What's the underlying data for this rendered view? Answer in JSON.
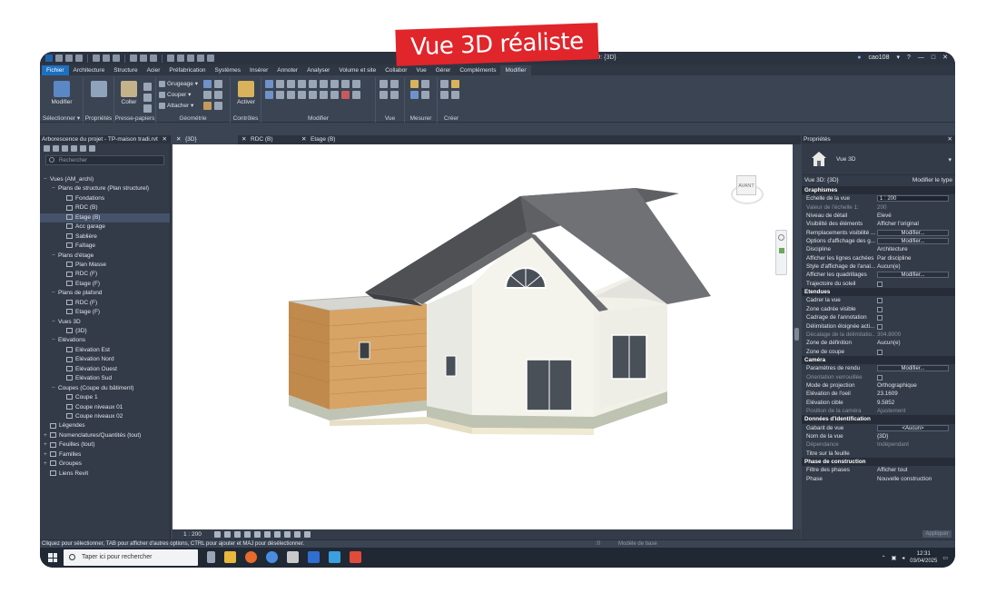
{
  "banner": "Vue 3D réaliste",
  "titlebar": {
    "view_title": "- 3D: {3D}",
    "user": "cao108"
  },
  "tabs": [
    "Fichier",
    "Architecture",
    "Structure",
    "Acier",
    "Préfabrication",
    "Systèmes",
    "Insérer",
    "Annoter",
    "Analyser",
    "Volume et site",
    "Collabor",
    "Vue",
    "Gérer",
    "Compléments",
    "Modifier"
  ],
  "ribbon": {
    "select": {
      "big": "Modifier",
      "label": "Sélectionner ▾"
    },
    "properties": {
      "label": "Propriétés"
    },
    "clipboard": {
      "big": "Coller",
      "label": "Presse-papiers"
    },
    "geometry": {
      "items": [
        "Grugeage ▾",
        "Couper ▾",
        "Attacher ▾"
      ],
      "label": "Géométrie"
    },
    "controls": {
      "big": "Activer",
      "label": "Contrôles"
    },
    "modify": {
      "label": "Modifier"
    },
    "view": {
      "label": "Vue"
    },
    "measure": {
      "label": "Mesurer"
    },
    "create": {
      "label": "Créer"
    }
  },
  "browser": {
    "title": "Arborescence du projet - TP-maison tradi.rvt",
    "search_placeholder": "Rechercher",
    "tree": [
      {
        "t": "Vues (AM_archi)",
        "toggle": "−",
        "indent": 0
      },
      {
        "t": "Plans de structure (Plan structurel)",
        "toggle": "−",
        "indent": 1
      },
      {
        "t": "Fondations",
        "indent": 2,
        "icon": true
      },
      {
        "t": "RDC (B)",
        "indent": 2,
        "icon": true
      },
      {
        "t": "Etage (B)",
        "indent": 2,
        "icon": true,
        "sel": true
      },
      {
        "t": "Acc garage",
        "indent": 2,
        "icon": true
      },
      {
        "t": "Sablière",
        "indent": 2,
        "icon": true
      },
      {
        "t": "Faîtage",
        "indent": 2,
        "icon": true
      },
      {
        "t": "Plans d'étage",
        "toggle": "−",
        "indent": 1
      },
      {
        "t": "Plan Masse",
        "indent": 2,
        "icon": true
      },
      {
        "t": "RDC (F)",
        "indent": 2,
        "icon": true
      },
      {
        "t": "Etage (F)",
        "indent": 2,
        "icon": true
      },
      {
        "t": "Plans de plafond",
        "toggle": "−",
        "indent": 1
      },
      {
        "t": "RDC (F)",
        "indent": 2,
        "icon": true
      },
      {
        "t": "Etage (F)",
        "indent": 2,
        "icon": true
      },
      {
        "t": "Vues 3D",
        "toggle": "−",
        "indent": 1
      },
      {
        "t": "{3D}",
        "indent": 2,
        "icon": true
      },
      {
        "t": "Elévations",
        "toggle": "−",
        "indent": 1
      },
      {
        "t": "Elévation Est",
        "indent": 2,
        "icon": true
      },
      {
        "t": "Elévation Nord",
        "indent": 2,
        "icon": true
      },
      {
        "t": "Elévation Ouest",
        "indent": 2,
        "icon": true
      },
      {
        "t": "Elévation Sud",
        "indent": 2,
        "icon": true
      },
      {
        "t": "Coupes (Coupe du bâtiment)",
        "toggle": "−",
        "indent": 1
      },
      {
        "t": "Coupe 1",
        "indent": 2,
        "icon": true
      },
      {
        "t": "Coupe niveaux 01",
        "indent": 2,
        "icon": true
      },
      {
        "t": "Coupe niveaux 02",
        "indent": 2,
        "icon": true
      },
      {
        "t": "Légendes",
        "indent": 0,
        "icon": true
      },
      {
        "t": "Nomenclatures/Quantités (tout)",
        "toggle": "+",
        "indent": 0,
        "icon": true
      },
      {
        "t": "Feuilles (tout)",
        "toggle": "+",
        "indent": 0,
        "icon": true
      },
      {
        "t": "Familles",
        "toggle": "+",
        "indent": 0,
        "icon": true
      },
      {
        "t": "Groupes",
        "toggle": "+",
        "indent": 0,
        "icon": true
      },
      {
        "t": "Liens Revit",
        "indent": 0,
        "icon": true
      }
    ]
  },
  "view_tabs": [
    "{3D}",
    "RDC (B)",
    "Etage (B)"
  ],
  "viewcube_label": "AVANT",
  "viewbar": {
    "scale": "1 : 200"
  },
  "properties": {
    "title": "Propriétés",
    "type_name": "Vue 3D",
    "selector": "Vue 3D: {3D}",
    "edit_type": "Modifier le type",
    "apply": "Appliquer",
    "rows": [
      {
        "sec": "Graphismes"
      },
      {
        "k": "Echelle de la vue",
        "v": "1 : 200",
        "kind": "input"
      },
      {
        "k": "Valeur de l'échelle    1:",
        "v": "200",
        "dim": true
      },
      {
        "k": "Niveau de détail",
        "v": "Elevé"
      },
      {
        "k": "Visibilité des éléments",
        "v": "Afficher l'original"
      },
      {
        "k": "Remplacements visibilité ...",
        "v": "Modifier...",
        "kind": "btn"
      },
      {
        "k": "Options d'affichage des g...",
        "v": "Modifier...",
        "kind": "btn"
      },
      {
        "k": "Discipline",
        "v": "Architecture"
      },
      {
        "k": "Afficher les lignes cachées",
        "v": "Par discipline"
      },
      {
        "k": "Style d'affichage de l'anal...",
        "v": "Aucun(e)"
      },
      {
        "k": "Afficher les quadrillages",
        "v": "Modifier...",
        "kind": "btn"
      },
      {
        "k": "Trajectoire du soleil",
        "kind": "cb"
      },
      {
        "sec": "Etendues"
      },
      {
        "k": "Cadrer la vue",
        "kind": "cb"
      },
      {
        "k": "Zone cadrée visible",
        "kind": "cb"
      },
      {
        "k": "Cadrage de l'annotation",
        "kind": "cb"
      },
      {
        "k": "Délimitation éloignée acti...",
        "kind": "cb"
      },
      {
        "k": "Décalage de la délimitatio...",
        "v": "304.8000",
        "dim": true
      },
      {
        "k": "Zone de définition",
        "v": "Aucun(e)"
      },
      {
        "k": "Zone de coupe",
        "kind": "cb"
      },
      {
        "sec": "Caméra"
      },
      {
        "k": "Paramètres de rendu",
        "v": "Modifier...",
        "kind": "btn"
      },
      {
        "k": "Orientation verrouillée",
        "kind": "cb",
        "dim": true
      },
      {
        "k": "Mode de projection",
        "v": "Orthographique"
      },
      {
        "k": "Elévation de l'oeil",
        "v": "23.1609"
      },
      {
        "k": "Elévation cible",
        "v": "9.5852"
      },
      {
        "k": "Position de la caméra",
        "v": "Ajustement",
        "dim": true
      },
      {
        "sec": "Données d'identification"
      },
      {
        "k": "Gabarit de vue",
        "v": "<Aucun>",
        "kind": "btn"
      },
      {
        "k": "Nom de la vue",
        "v": "{3D}"
      },
      {
        "k": "Dépendance",
        "v": "Indépendant",
        "dim": true
      },
      {
        "k": "Titre sur la feuille",
        "v": ""
      },
      {
        "sec": "Phase de construction"
      },
      {
        "k": "Filtre des phases",
        "v": "Afficher tout"
      },
      {
        "k": "Phase",
        "v": "Nouvelle construction"
      }
    ]
  },
  "status": {
    "hint": "Cliquez pour sélectionner, TAB pour afficher d'autres options, CTRL pour ajouter et MAJ pour désélectionner.",
    "count": ":0",
    "model": "Modèle de base"
  },
  "taskbar": {
    "search_placeholder": "Taper ici pour rechercher",
    "time": "12:31",
    "date": "03/04/2025"
  },
  "colors": {
    "file_tab": "#1d6fc2",
    "banner": "#e0252b",
    "panel": "#3b4453"
  }
}
